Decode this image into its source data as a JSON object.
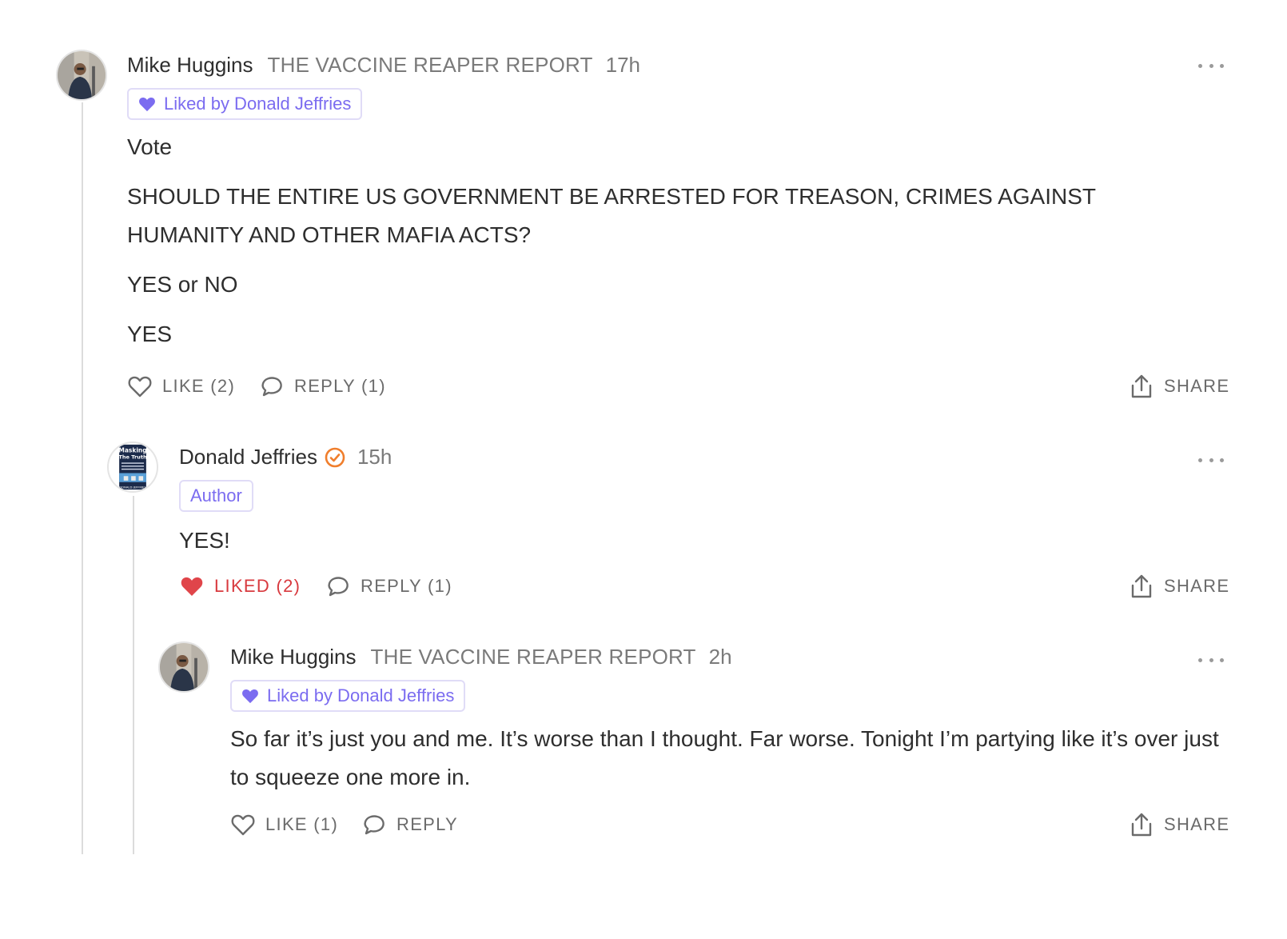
{
  "comments": [
    {
      "author": "Mike Huggins",
      "publication": "THE VACCINE REAPER REPORT",
      "time": "17h",
      "badge": "Liked by Donald Jeffries",
      "body": [
        "Vote",
        "SHOULD THE ENTIRE US GOVERNMENT BE ARRESTED FOR TREASON, CRIMES AGAINST HUMANITY AND OTHER MAFIA ACTS?",
        "YES or NO",
        "YES"
      ],
      "like_label": "LIKE (2)",
      "reply_label": "REPLY (1)",
      "share_label": "SHARE"
    },
    {
      "author": "Donald Jeffries",
      "time": "15h",
      "badge": "Author",
      "avatar_text": [
        "Masking",
        "The Truth",
        "DONALD JEFFRIES"
      ],
      "body": [
        "YES!"
      ],
      "like_label": "LIKED (2)",
      "reply_label": "REPLY (1)",
      "share_label": "SHARE"
    },
    {
      "author": "Mike Huggins",
      "publication": "THE VACCINE REAPER REPORT",
      "time": "2h",
      "badge": "Liked by Donald Jeffries",
      "body": [
        "So far it’s just you and me. It’s worse than I thought. Far worse. Tonight I’m partying like it’s over just to squeeze one more in."
      ],
      "like_label": "LIKE (1)",
      "reply_label": "REPLY",
      "share_label": "SHARE"
    }
  ],
  "colors": {
    "accent": "#7b6cf0",
    "liked": "#e0454a",
    "verified": "#f07e2c",
    "muted": "#7a7a7a",
    "thread_line": "#dcdcdc"
  },
  "icons": [
    "heart-icon",
    "heart-filled-icon",
    "comment-bubble-icon",
    "share-icon",
    "more-dots-icon",
    "verified-check-icon"
  ]
}
